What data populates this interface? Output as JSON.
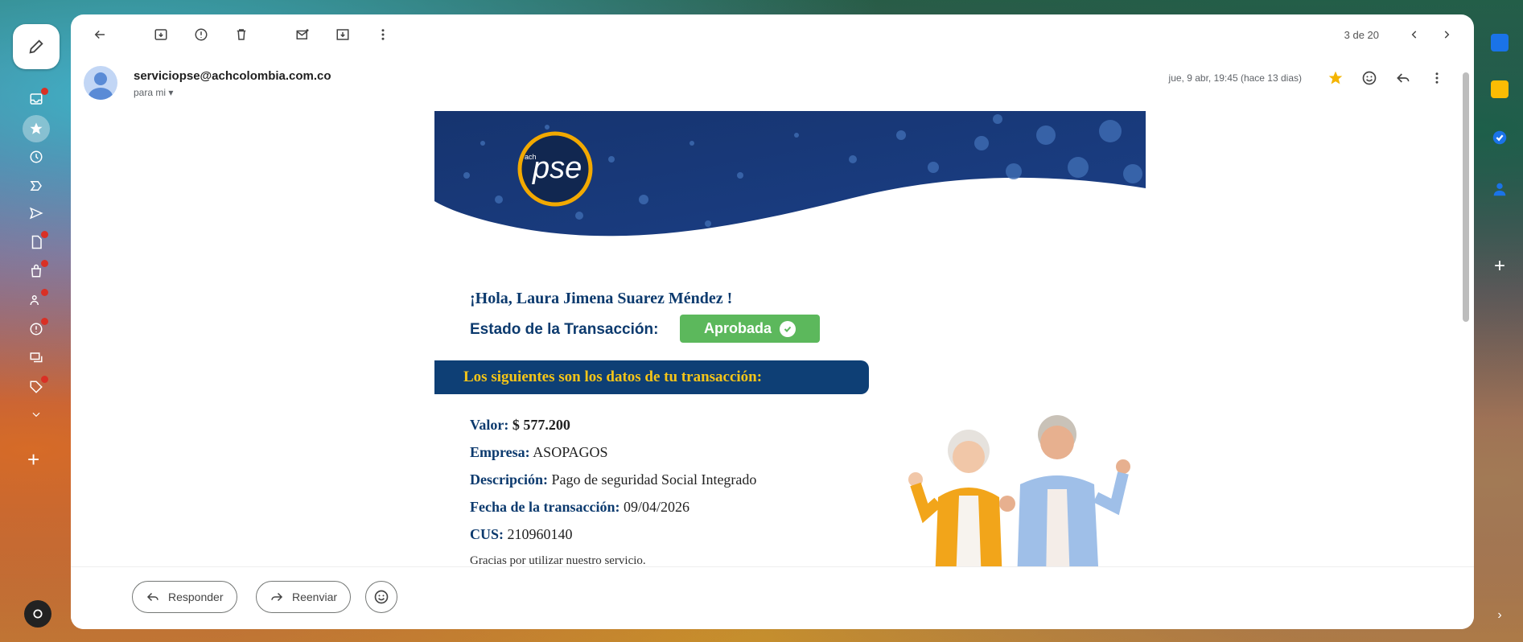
{
  "toolbar": {
    "page_count": "3 de 20"
  },
  "message": {
    "sender_email": "serviciopse@achcolombia.com.co",
    "to_label": "para mi",
    "date": "jue, 9 abr, 19:45 (hace 13 dias)"
  },
  "email": {
    "brand": "pse",
    "brand_small": "ach",
    "greeting": "¡Hola, Laura Jimena Suarez Méndez !",
    "status_label": "Estado de la Transacción:",
    "status_value": "Aprobada",
    "data_header": "Los siguientes son los datos de tu transacción:",
    "details": [
      {
        "key": "Valor:",
        "value": "$ 577.200"
      },
      {
        "key": "Empresa:",
        "value": "ASOPAGOS"
      },
      {
        "key": "Descripción:",
        "value": "Pago de seguridad Social Integrado"
      },
      {
        "key": "Fecha de la transacción:",
        "value": "09/04/2026"
      },
      {
        "key": "CUS:",
        "value": "210960140"
      }
    ],
    "thanks": "Gracias por utilizar nuestro servicio."
  },
  "footer": {
    "reply_label": "Responder",
    "forward_label": "Reenviar"
  },
  "colors": {
    "brand_navy": "#0e3f75",
    "status_green": "#5cb85c",
    "accent_yellow": "#f5c518",
    "star": "#f4b400"
  }
}
